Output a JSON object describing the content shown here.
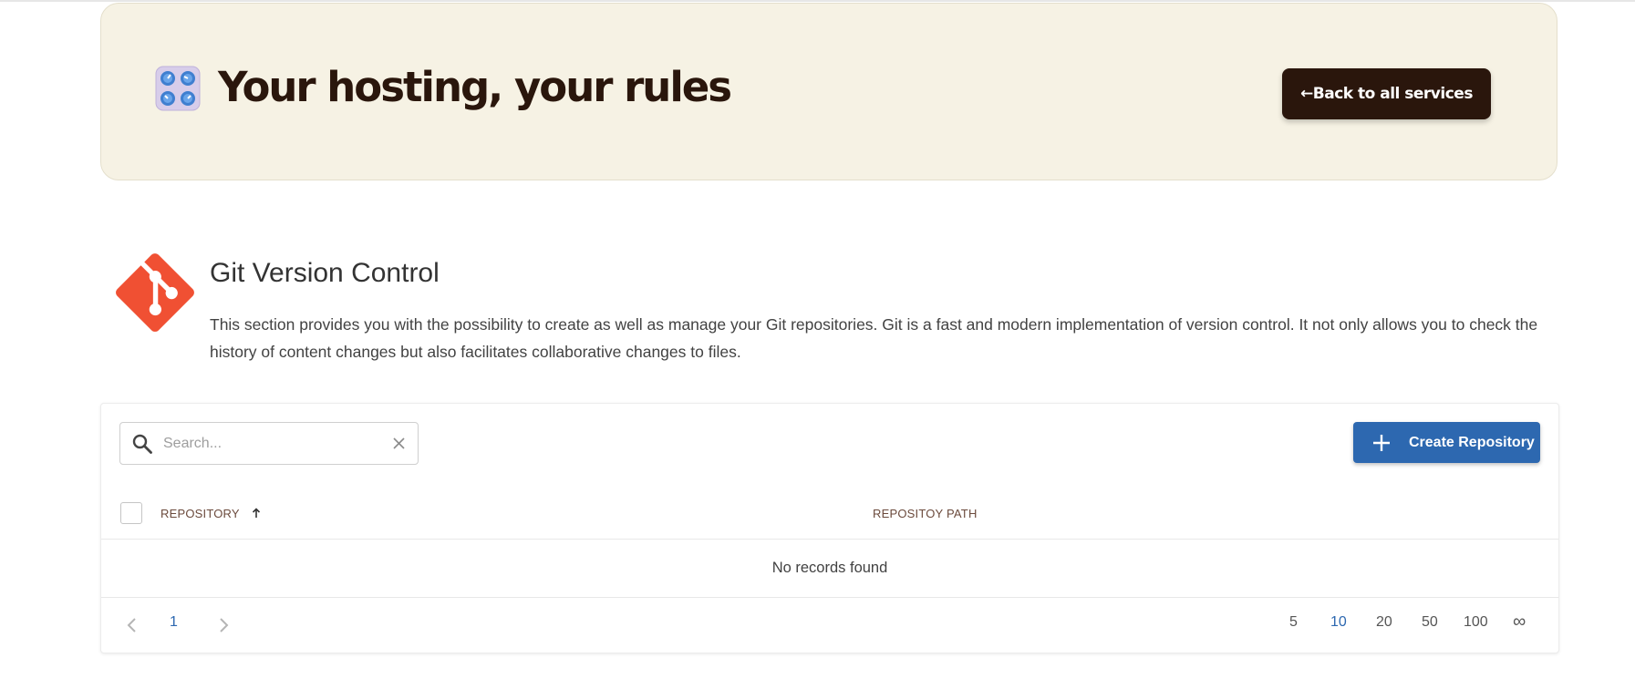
{
  "hero": {
    "title": "Your hosting, your rules",
    "back_button_label": "←Back to all services",
    "icon": "control-knobs-icon"
  },
  "section": {
    "title": "Git Version Control",
    "description": "This section provides you with the possibility to create as well as manage your Git repositories. Git is a fast and modern implementation of version control. It not only allows you to check the history of content changes but also facilitates collaborative changes to files.",
    "icon": "git-logo-icon"
  },
  "toolbar": {
    "search_placeholder": "Search...",
    "search_value": "",
    "create_button_label": "Create Repository"
  },
  "table": {
    "columns": [
      "REPOSITORY",
      "REPOSITOY PATH"
    ],
    "sort": {
      "column": "REPOSITORY",
      "direction": "ascending"
    },
    "rows": [],
    "empty_message": "No records found"
  },
  "pagination": {
    "current_page": "1",
    "page_sizes": [
      "5",
      "10",
      "20",
      "50",
      "100",
      "∞"
    ],
    "selected_page_size": "10"
  },
  "colors": {
    "hero_background": "#f6f2e4",
    "hero_text": "#2a160c",
    "back_button": "#2a160c",
    "primary": "#2d68b0",
    "git_logo": "#f05033"
  }
}
